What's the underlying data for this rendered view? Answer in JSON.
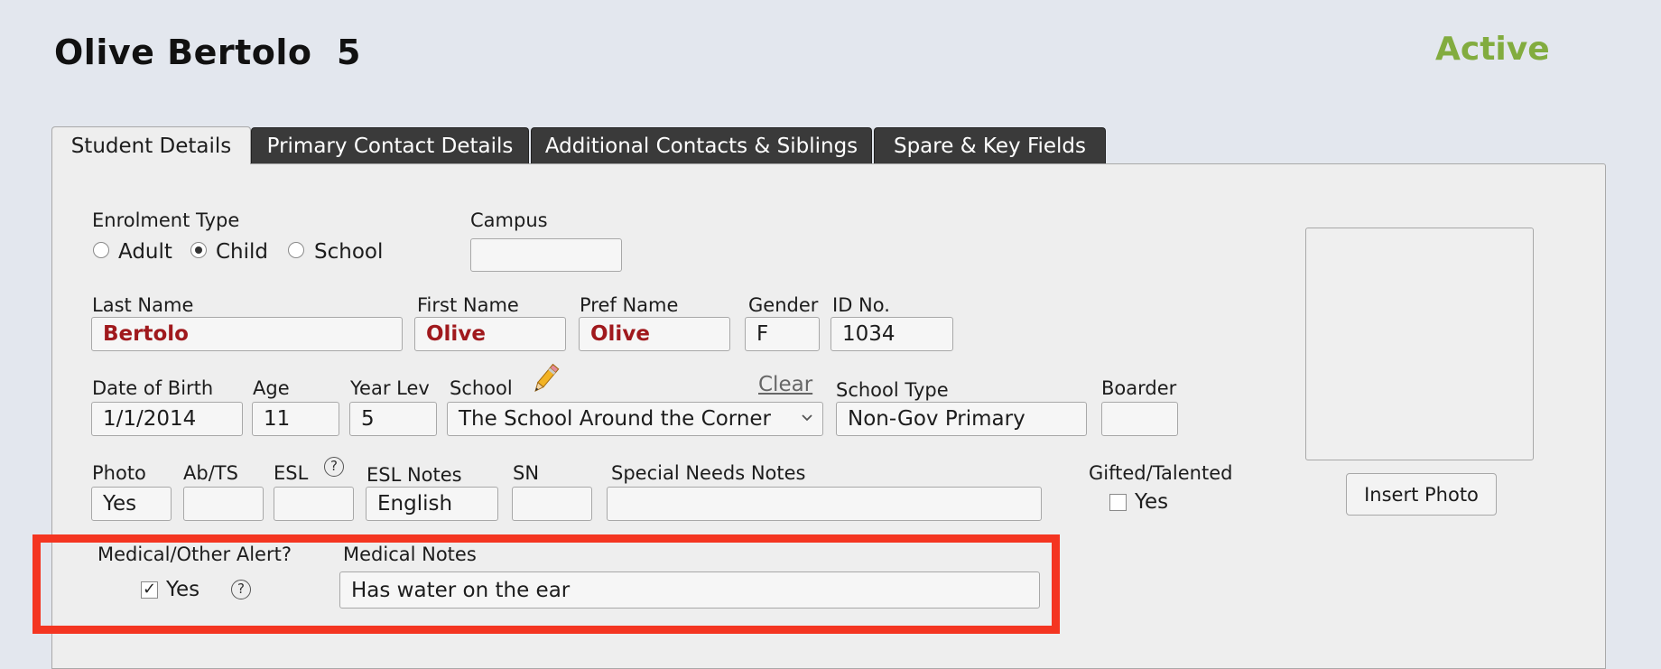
{
  "header": {
    "title": "Olive Bertolo  5",
    "status": "Active"
  },
  "tabs": [
    {
      "label": "Student Details"
    },
    {
      "label": "Primary Contact Details"
    },
    {
      "label": "Additional Contacts & Siblings"
    },
    {
      "label": "Spare & Key Fields"
    }
  ],
  "form": {
    "enrolment_type": {
      "label": "Enrolment Type",
      "options": [
        "Adult",
        "Child",
        "School"
      ],
      "selected": "Child"
    },
    "campus": {
      "label": "Campus",
      "value": ""
    },
    "last_name": {
      "label": "Last Name",
      "value": "Bertolo"
    },
    "first_name": {
      "label": "First Name",
      "value": "Olive"
    },
    "pref_name": {
      "label": "Pref Name",
      "value": "Olive"
    },
    "gender": {
      "label": "Gender",
      "value": "F"
    },
    "id_no": {
      "label": "ID No.",
      "value": "1034"
    },
    "dob": {
      "label": "Date of Birth",
      "value": "1/1/2014"
    },
    "age": {
      "label": "Age",
      "value": "11"
    },
    "year_lev": {
      "label": "Year Lev",
      "value": "5"
    },
    "school": {
      "label": "School",
      "value": "The School Around the Corner",
      "clear_label": "Clear"
    },
    "school_type": {
      "label": "School Type",
      "value": "Non-Gov Primary"
    },
    "boarder": {
      "label": "Boarder",
      "value": ""
    },
    "photo": {
      "label": "Photo",
      "value": "Yes"
    },
    "ab_ts": {
      "label": "Ab/TS",
      "value": ""
    },
    "esl": {
      "label": "ESL",
      "value": ""
    },
    "esl_notes": {
      "label": "ESL Notes",
      "value": "English"
    },
    "sn": {
      "label": "SN",
      "value": ""
    },
    "special_needs_notes": {
      "label": "Special Needs Notes",
      "value": ""
    },
    "gifted": {
      "label": "Gifted/Talented",
      "option": "Yes",
      "checked": false
    },
    "medical_alert": {
      "label": "Medical/Other Alert?",
      "option": "Yes",
      "checked": true
    },
    "medical_notes": {
      "label": "Medical Notes",
      "value": "Has water on the ear"
    },
    "help_glyph": "?",
    "check_glyph": "✓"
  },
  "photo_panel": {
    "insert_label": "Insert Photo"
  },
  "colors": {
    "status": "#82ac3f",
    "required_text": "#a0191d",
    "highlight": "#f43521",
    "tab_dark": "#3a3a3a"
  },
  "icons": {
    "school_edit": "pencil-icon",
    "school_dropdown": "chevron-down-icon",
    "help": "help-icon"
  }
}
